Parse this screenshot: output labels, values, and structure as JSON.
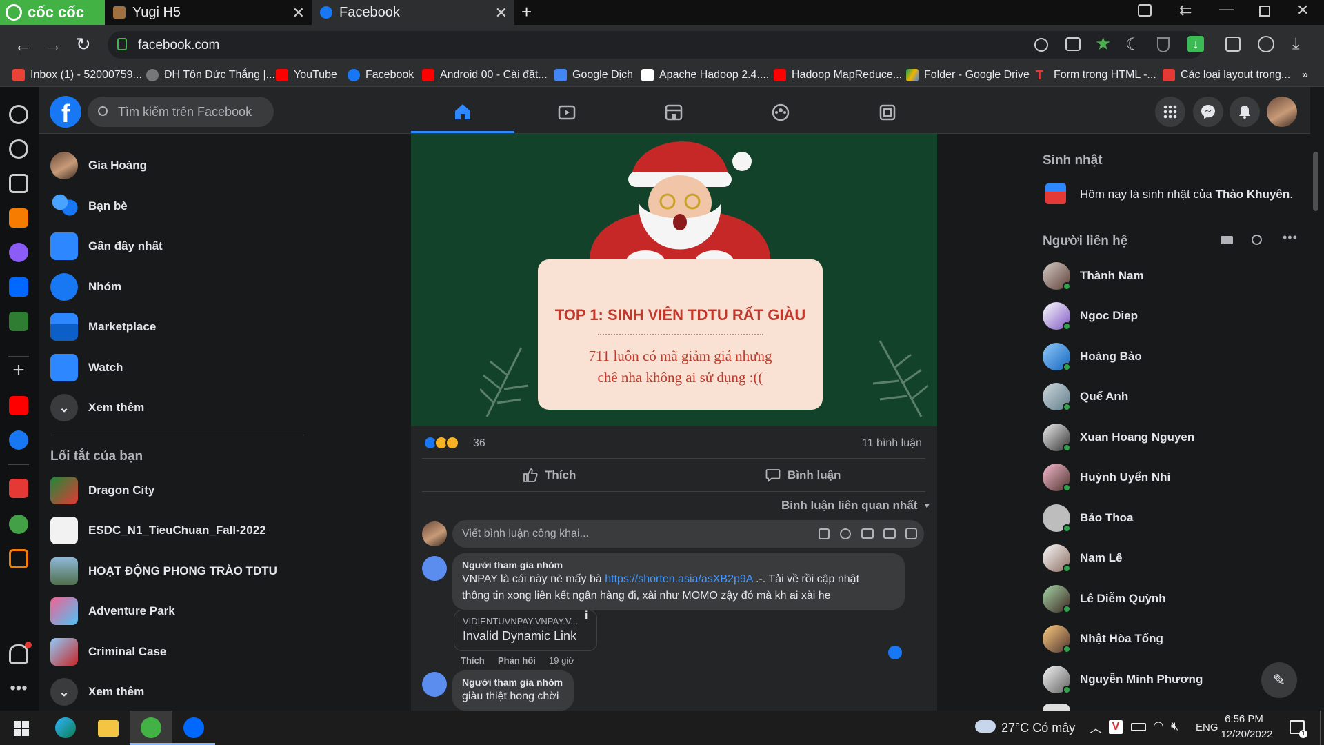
{
  "browser": {
    "brand": "cốc cốc",
    "tabs": [
      {
        "title": "Yugi H5"
      },
      {
        "title": "Facebook"
      }
    ],
    "url": "facebook.com",
    "bookmarks": [
      "Inbox (1) - 52000759...",
      "ĐH Tôn Đức Thắng |...",
      "YouTube",
      "Facebook",
      "Android 00 - Cài đặt...",
      "Google Dịch",
      "Apache Hadoop 2.4....",
      "Hadoop MapReduce...",
      "Folder - Google Drive",
      "Form trong HTML -...",
      "Các loại layout trong..."
    ],
    "more_bookmarks": "»"
  },
  "fb": {
    "search_placeholder": "Tìm kiếm trên Facebook",
    "left_menu": [
      "Gia Hoàng",
      "Bạn bè",
      "Gần đây nhất",
      "Nhóm",
      "Marketplace",
      "Watch",
      "Xem thêm"
    ],
    "shortcuts_title": "Lối tắt của bạn",
    "shortcuts": [
      "Dragon City",
      "ESDC_N1_TieuChuan_Fall-2022",
      "HOẠT ĐỘNG PHONG TRÀO TDTU",
      "Adventure Park",
      "Criminal Case",
      "Xem thêm"
    ],
    "post": {
      "card_title": "TOP 1: SINH VIÊN TDTU RẤT GIÀU",
      "card_line1": "711 luôn có mã giảm giá nhưng",
      "card_line2": "chê nha không ai sử dụng :((",
      "reactions": "36",
      "comments_count": "11 bình luận",
      "like": "Thích",
      "comment": "Bình luận",
      "sort": "Bình luận liên quan nhất",
      "write_placeholder": "Viết bình luận công khai...",
      "c1_author": "Người tham gia nhóm",
      "c1_pre": "VNPAY là cái này nè mấy bà ",
      "c1_link": "https://shorten.asia/asXB2p9A",
      "c1_post": " .-. Tải về rồi cập nhật",
      "c1_line2": "thông tin xong liên kết ngân hàng đi, xài như MOMO zậy đó mà kh ai xài he",
      "preview_domain": "VIDIENTUVNPAY.VNPAY.V...",
      "preview_title": "Invalid Dynamic Link",
      "c1_like": "Thích",
      "c1_reply": "Phản hồi",
      "c1_time": "19 giờ",
      "c2_author": "Người tham gia nhóm",
      "c2_text": "giàu thiệt hong chời"
    },
    "right": {
      "birthday_title": "Sinh nhật",
      "birthday_pre": "Hôm nay là sinh nhật của ",
      "birthday_name": "Thảo Khuyên",
      "birthday_post": ".",
      "contacts_title": "Người liên hệ",
      "contacts": [
        "Thành Nam",
        "Ngoc Diep",
        "Hoàng Bảo",
        "Quế Anh",
        "Xuan Hoang Nguyen",
        "Huỳnh Uyển Nhi",
        "Bảo Thoa",
        "Nam Lê",
        "Lê Diễm Quỳnh",
        "Nhật Hòa Tống",
        "Nguyễn Minh Phương"
      ]
    }
  },
  "taskbar": {
    "weather": "27°C  Có mây",
    "lang": "ENG",
    "time": "6:56 PM",
    "date": "12/20/2022"
  },
  "colors": {
    "accent": "#2d88ff",
    "bg": "#18191a",
    "card": "#242526",
    "online": "#31a24c",
    "post_bg": "#12422a",
    "card_title": "#c0392b"
  }
}
